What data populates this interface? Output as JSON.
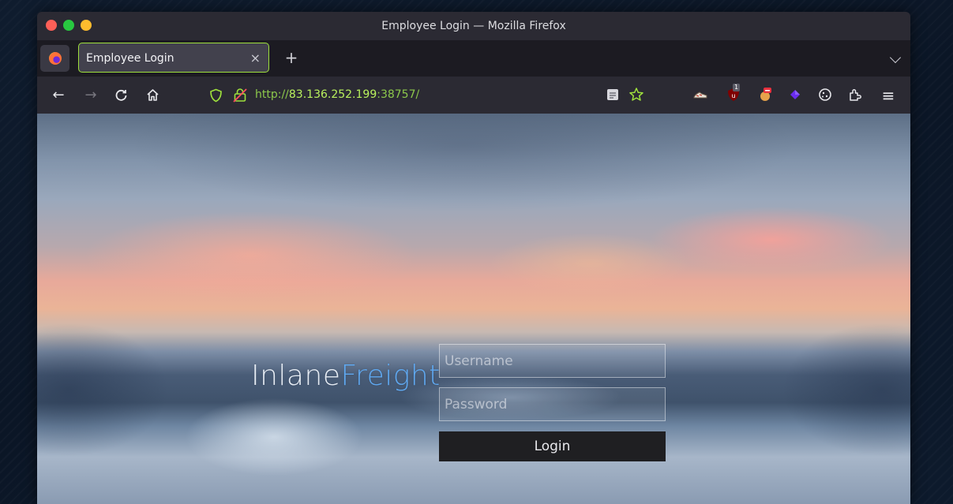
{
  "window": {
    "title": "Employee Login — Mozilla Firefox"
  },
  "tabs": [
    {
      "label": "Employee Login",
      "active": true
    }
  ],
  "tab_close_glyph": "×",
  "new_tab_glyph": "+",
  "navbar": {
    "back_glyph": "←",
    "forward_glyph": "→",
    "reload_glyph": "C",
    "url": {
      "scheme": "http://",
      "host": "83.136.252.199",
      "port_path": ":38757/"
    },
    "menu_glyph": "≡"
  },
  "extensions": [
    {
      "name": "reader-icon"
    },
    {
      "name": "bookmark-star-icon"
    },
    {
      "name": "extension-sneaker-icon"
    },
    {
      "name": "ublock-origin-icon",
      "badge": "1"
    },
    {
      "name": "extension-noscript-icon"
    },
    {
      "name": "extension-diamond-icon"
    },
    {
      "name": "cookie-icon"
    },
    {
      "name": "puzzle-extensions-icon"
    }
  ],
  "page": {
    "brand_part1": "Inlane",
    "brand_part2": "Freight",
    "username_placeholder": "Username",
    "password_placeholder": "Password",
    "login_label": "Login"
  },
  "colors": {
    "accent": "#9ee03c",
    "brand_blue": "#5fa8f0",
    "url_host": "#b9f15d"
  }
}
